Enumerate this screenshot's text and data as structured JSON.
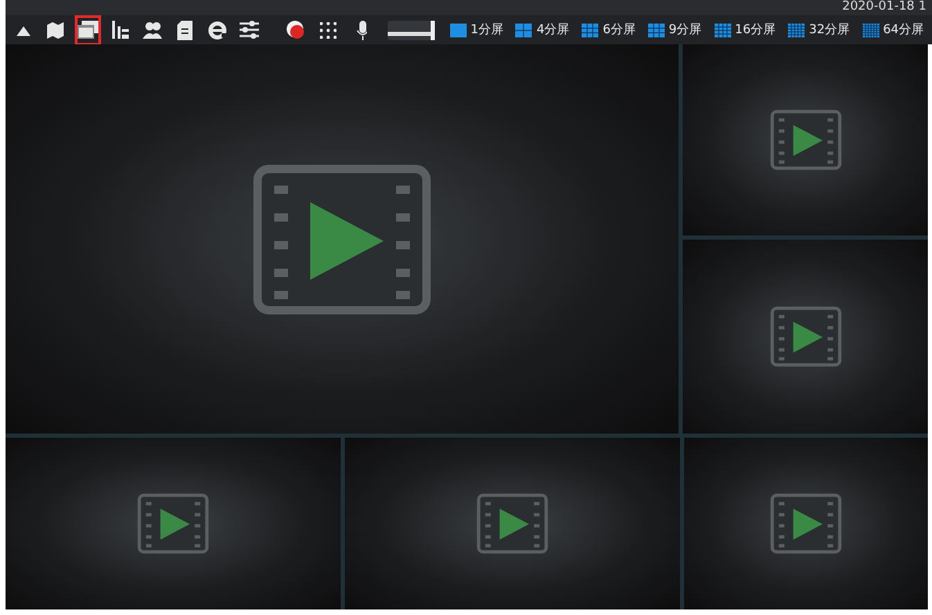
{
  "clock": "2020-01-18 1",
  "toolbar": {
    "tools": [
      {
        "kind": "collapse",
        "selected": false
      },
      {
        "kind": "map",
        "selected": false
      },
      {
        "kind": "windows",
        "selected": true
      },
      {
        "kind": "chart",
        "selected": false
      },
      {
        "kind": "users",
        "selected": false
      },
      {
        "kind": "document",
        "selected": false
      },
      {
        "kind": "browser",
        "selected": false
      },
      {
        "kind": "sliders",
        "selected": false
      },
      {
        "kind": "record",
        "selected": false
      },
      {
        "kind": "grid",
        "selected": false
      }
    ],
    "volume": {
      "level": 1
    },
    "layouts": [
      {
        "label": "1分屏"
      },
      {
        "label": "4分屏"
      },
      {
        "label": "6分屏"
      },
      {
        "label": "9分屏"
      },
      {
        "label": "16分屏"
      },
      {
        "label": "32分屏"
      },
      {
        "label": "64分屏"
      }
    ]
  },
  "video_panes": [
    {
      "kind": "large"
    },
    {
      "kind": "small"
    },
    {
      "kind": "small"
    },
    {
      "kind": "small"
    },
    {
      "kind": "small"
    },
    {
      "kind": "small"
    }
  ]
}
